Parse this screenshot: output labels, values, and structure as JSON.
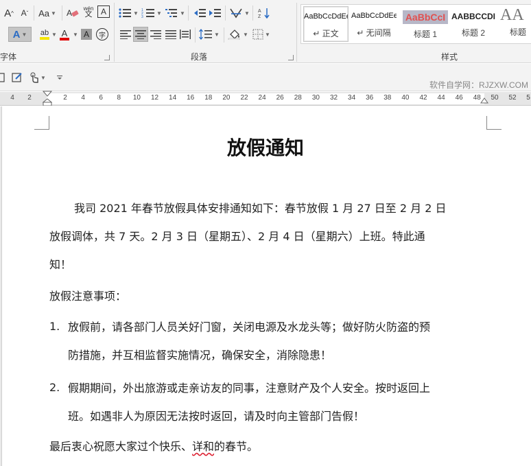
{
  "ribbon": {
    "groups": {
      "font_partial": "字体",
      "paragraph": "段落",
      "styles": "样式"
    },
    "font": {
      "grow_font": "A",
      "shrink_font": "A",
      "change_case": "Aa",
      "clear_format_icon": "eraser-icon",
      "phonetic_top": "wén",
      "phonetic_bottom": "文",
      "char_border": "A",
      "text_effect": "A",
      "highlight": "ab",
      "font_color": "A",
      "char_shading": "A",
      "enclose_char": "字",
      "highlight_color": "#f5e600",
      "font_color_value": "#e00000",
      "text_effect_color": "#2b6cc4"
    },
    "styles": [
      {
        "sample": "AaBbCcDdEe",
        "name": "↵ 正文",
        "selected": true
      },
      {
        "sample": "AaBbCcDdEe",
        "name": "↵ 无间隔",
        "selected": false
      },
      {
        "sample": "AaBbCcI",
        "name": "标题 1",
        "selected": false
      },
      {
        "sample": "AABBCCDI",
        "name": "标题 2",
        "selected": false
      },
      {
        "sample": "AA",
        "name": "标题",
        "selected": false
      }
    ],
    "heading1_color": "#e05050"
  },
  "qat": {
    "watermark": "软件自学网：RJZXW.COM"
  },
  "ruler": {
    "left_labels": [
      "4",
      "2"
    ],
    "labels": [
      "2",
      "4",
      "6",
      "8",
      "10",
      "12",
      "14",
      "16",
      "18",
      "20",
      "22",
      "24",
      "26",
      "28",
      "30",
      "32",
      "34",
      "36",
      "38",
      "40",
      "42",
      "44",
      "46",
      "48"
    ],
    "right_labels": [
      "50",
      "52",
      "5"
    ]
  },
  "document": {
    "title": "放假通知",
    "para1_line1": "我司 2021 年春节放假具体安排通知如下：春节放假 1 月 27 日至 2 月 2 日",
    "para1_line2": "放假调体，共 7 天。2 月 3 日（星期五）、2 月 4 日（星期六）上班。特此通",
    "para1_line3": "知！",
    "notes_heading": "放假注意事项：",
    "item1_num": "1.",
    "item1_line1": "放假前，请各部门人员关好门窗，关闭电源及水龙头等；做好防火防盗的预",
    "item1_line2": "防措施，并互相监督实施情况，确保安全，消除隐患！",
    "item2_num": "2.",
    "item2_line1": "假期期间，外出旅游或走亲访友的同事，注意财产及个人安全。按时返回上",
    "item2_line2": "班。如遇非人为原因无法按时返回，请及时向主管部门告假！",
    "closing_before": "最后衷心祝愿大家过个快乐、",
    "closing_flagged": "详和",
    "closing_after": "的春节。"
  }
}
